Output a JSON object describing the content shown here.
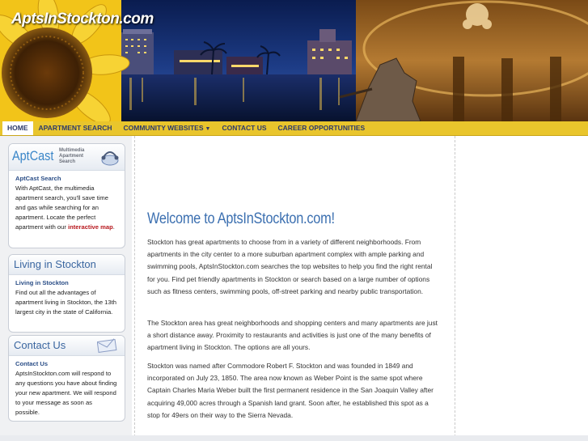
{
  "banner": {
    "logo_text": "AptsInStockton.com"
  },
  "nav": {
    "items": [
      {
        "label": "HOME"
      },
      {
        "label": "APARTMENT SEARCH"
      },
      {
        "label": "COMMUNITY WEBSITES"
      },
      {
        "label": "CONTACT US"
      },
      {
        "label": "CAREER OPPORTUNITIES"
      }
    ]
  },
  "sidebar": {
    "aptcast": {
      "logo": "AptCast",
      "tagline": [
        "Multimedia",
        "Apartment",
        "Search"
      ],
      "subtitle": "AptCast Search",
      "text": "With AptCast, the multimedia apartment search, you'll save time and gas while searching for an apartment. Locate the perfect apartment with our",
      "link": "interactive map",
      "end": "."
    },
    "living": {
      "title": "Living in Stockton",
      "subtitle": "Living in Stockton",
      "text": "Find out all the advantages of apartment living in Stockton, the 13th largest city in the state of California."
    },
    "contact": {
      "title": "Contact Us",
      "subtitle": "Contact Us",
      "text": "AptsInStockton.com will respond to any questions you have about finding your new apartment. We will respond to your message as soon as possible."
    }
  },
  "main": {
    "welcome": "Welcome to AptsInStockton.com!",
    "paragraphs": [
      "Stockton has great apartments to choose from in a variety of different neighborhoods. From apartments in the city center to a more suburban apartment complex with ample parking and swimming pools, AptsInStockton.com searches the top websites to help you find the right rental for you. Find pet friendly apartments in Stockton or search based on a large number of options such as fitness centers, swimming pools, off-street parking and nearby public transportation.",
      "The Stockton area has great neighborhoods and shopping centers and many apartments are just a short distance away. Proximity to restaurants and activities is just one of the many benefits of apartment living in Stockton. The options are all yours.",
      "Stockton was named after Commodore Robert F. Stockton and was founded in 1849 and incorporated on July 23, 1850. The area now known as Weber Point is the same spot where Captain Charles Maria Weber built the first permanent residence in the San Joaquin Valley after acquiring 49,000 acres through a Spanish land grant. Soon after, he established this spot as a stop for 49ers on their way to the Sierra Nevada."
    ]
  },
  "colors": {
    "nav_bg": "#e9c52c",
    "nav_text": "#2d3a6b",
    "heading_blue": "#3b6fb0",
    "link_red": "#b7171d"
  },
  "icons": {
    "caret": "chevron-down-icon",
    "envelope": "envelope-icon",
    "headset": "headset-icon"
  }
}
